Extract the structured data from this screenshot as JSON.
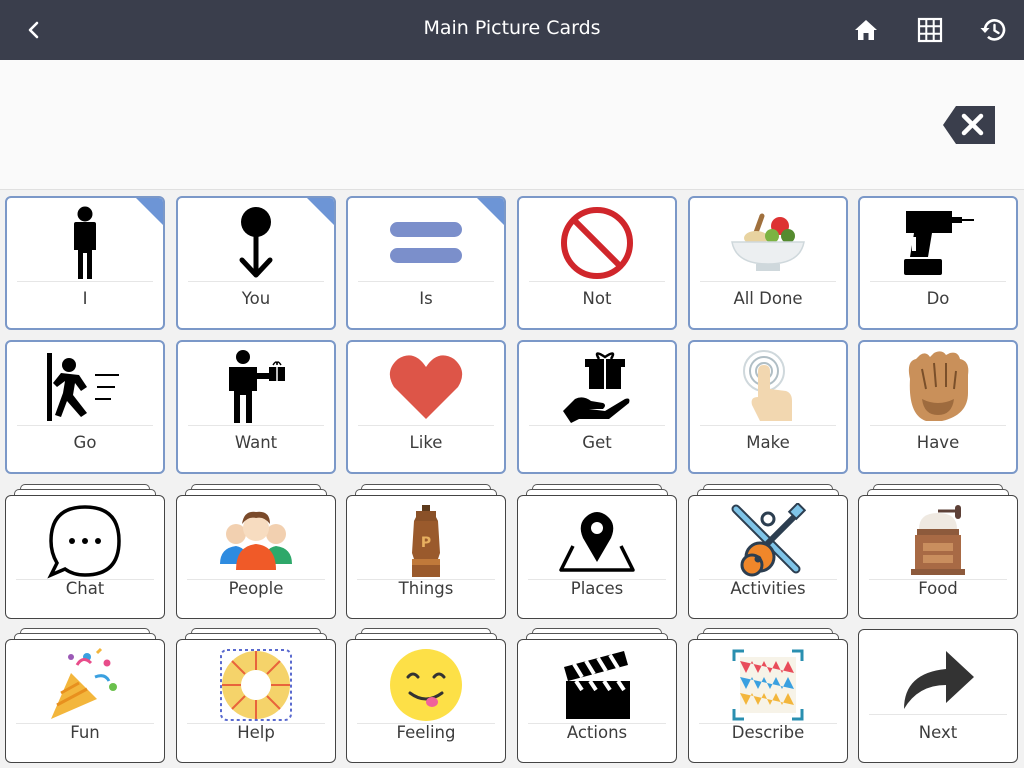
{
  "header": {
    "title": "Main Picture Cards",
    "back_icon": "chevron-left-icon",
    "home_icon": "home-icon",
    "grid_icon": "grid-icon",
    "history_icon": "history-icon"
  },
  "sentence_bar": {
    "backspace_icon": "backspace-icon"
  },
  "colors": {
    "header_bg": "#3a3e4c",
    "blue_border": "#7b98c8",
    "corner": "#6d95d6"
  },
  "cards": [
    {
      "label": "I"
    },
    {
      "label": "You"
    },
    {
      "label": "Is"
    },
    {
      "label": "Not"
    },
    {
      "label": "All Done"
    },
    {
      "label": "Do"
    },
    {
      "label": "Go"
    },
    {
      "label": "Want"
    },
    {
      "label": "Like"
    },
    {
      "label": "Get"
    },
    {
      "label": "Make"
    },
    {
      "label": "Have"
    },
    {
      "label": "Chat"
    },
    {
      "label": "People"
    },
    {
      "label": "Things"
    },
    {
      "label": "Places"
    },
    {
      "label": "Activities"
    },
    {
      "label": "Food"
    },
    {
      "label": "Fun"
    },
    {
      "label": "Help"
    },
    {
      "label": "Feeling"
    },
    {
      "label": "Actions"
    },
    {
      "label": "Describe"
    },
    {
      "label": "Next"
    }
  ]
}
